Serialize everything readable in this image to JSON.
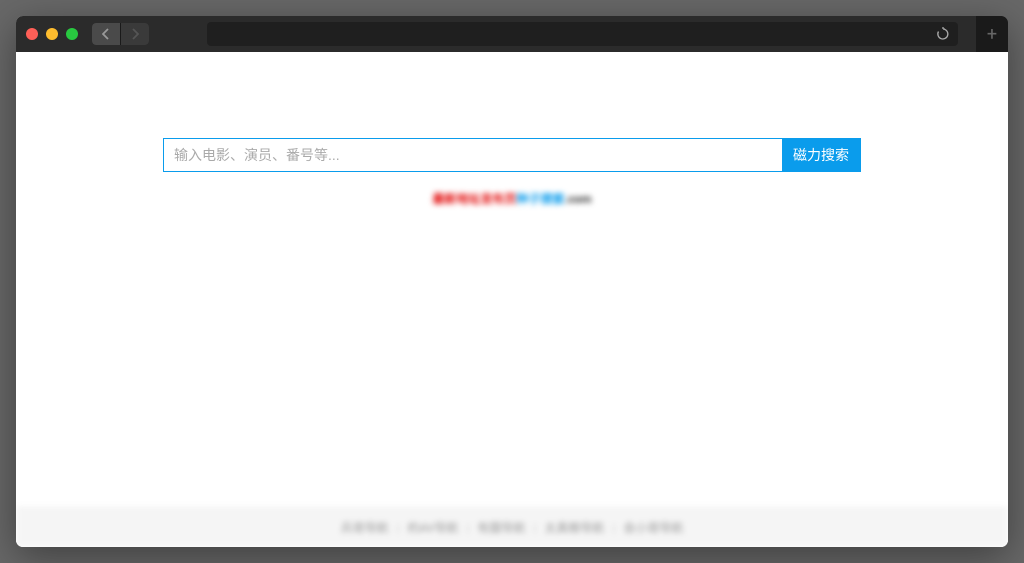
{
  "browser": {
    "nav_back": "‹",
    "nav_forward": "›",
    "reload": "↻",
    "new_tab": "+"
  },
  "search": {
    "placeholder": "输入电影、演员、番号等...",
    "button_label": "磁力搜索"
  },
  "notice": {
    "part1_red": "最新地址发布页",
    "part2_blue": "种子搜索",
    "part3_black": ".com"
  },
  "footer": {
    "links": [
      "兵哥导航",
      "約AV导航",
      "有圖导航",
      "太真粮导航",
      "会小哥导航"
    ],
    "separator": "|"
  }
}
